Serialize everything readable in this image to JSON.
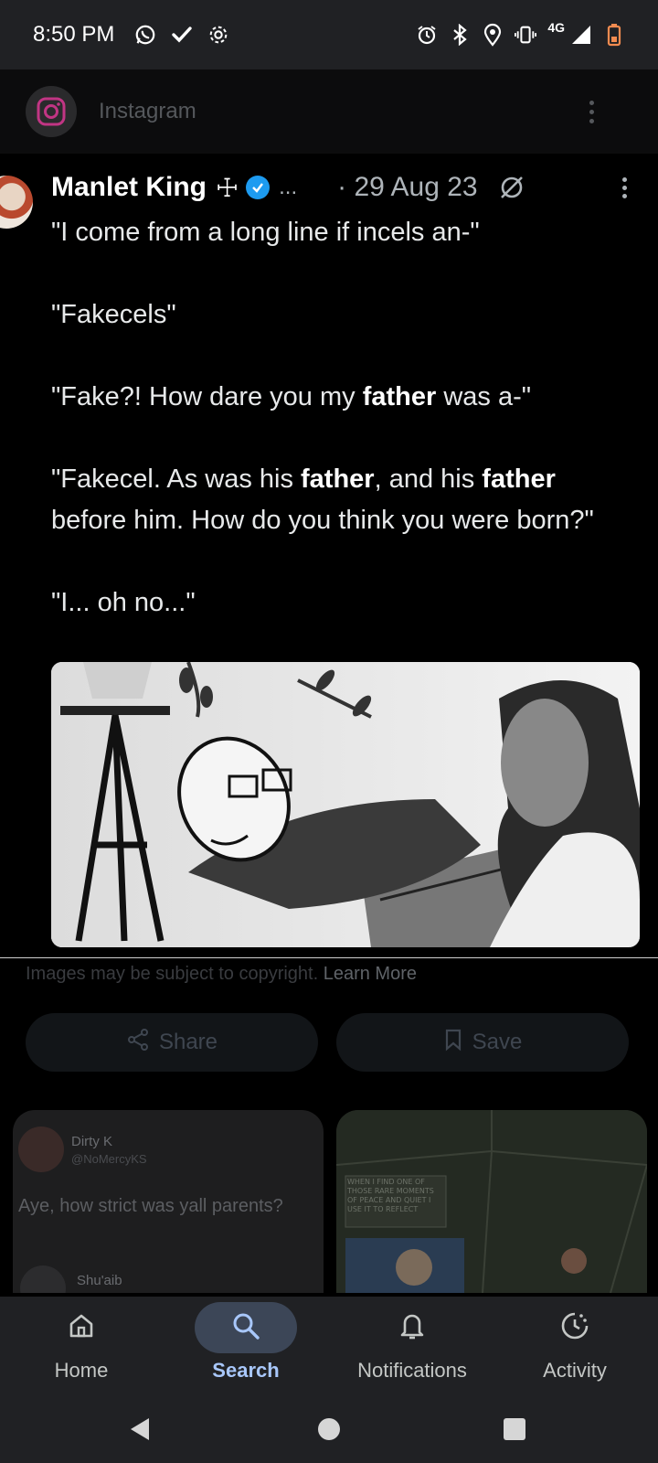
{
  "status_bar": {
    "time": "8:50 PM",
    "network": "4G",
    "left_icons": [
      "whatsapp-icon",
      "check-icon",
      "settings-icon"
    ],
    "right_icons": [
      "alarm-icon",
      "bluetooth-icon",
      "location-icon",
      "vibrate-icon",
      "signal-icon",
      "battery-low-icon"
    ]
  },
  "source": {
    "name": "Instagram"
  },
  "tweet": {
    "author": "Manlet King",
    "symbol": "☩",
    "ellipsis": "...",
    "date": "· 29 Aug 23",
    "lines": [
      "\"I come from a long line if incels an-\"",
      "\"Fakecels\"",
      "\"Fake?! How dare you my ",
      "father",
      " was a-\"",
      "\"Fakecel. As was his ",
      "father",
      ", and his ",
      "father",
      " before him. How do you think you were born?\"",
      "\"I... oh no...\""
    ]
  },
  "copyright": {
    "text": "Images may be subject to copyright.",
    "link": "Learn More"
  },
  "actions": {
    "share": "Share",
    "save": "Save"
  },
  "cards": {
    "left": {
      "user1_name": "Dirty K",
      "user1_handle": "@NoMercyKS",
      "text": "Aye, how strict was yall parents?",
      "user2_name": "Shu'aib"
    },
    "right": {
      "caption": "WHEN I FIND ONE OF THOSE RARE MOMENTS OF PEACE AND QUIET I USE IT TO REFLECT"
    }
  },
  "bottom_nav": {
    "items": [
      {
        "label": "Home",
        "icon": "home-icon"
      },
      {
        "label": "Search",
        "icon": "search-icon",
        "active": true
      },
      {
        "label": "Notifications",
        "icon": "bell-icon"
      },
      {
        "label": "Activity",
        "icon": "activity-icon"
      }
    ]
  },
  "colors": {
    "accent": "#a8c7fa",
    "verified": "#1d9bf0",
    "battery": "#f28b50"
  }
}
